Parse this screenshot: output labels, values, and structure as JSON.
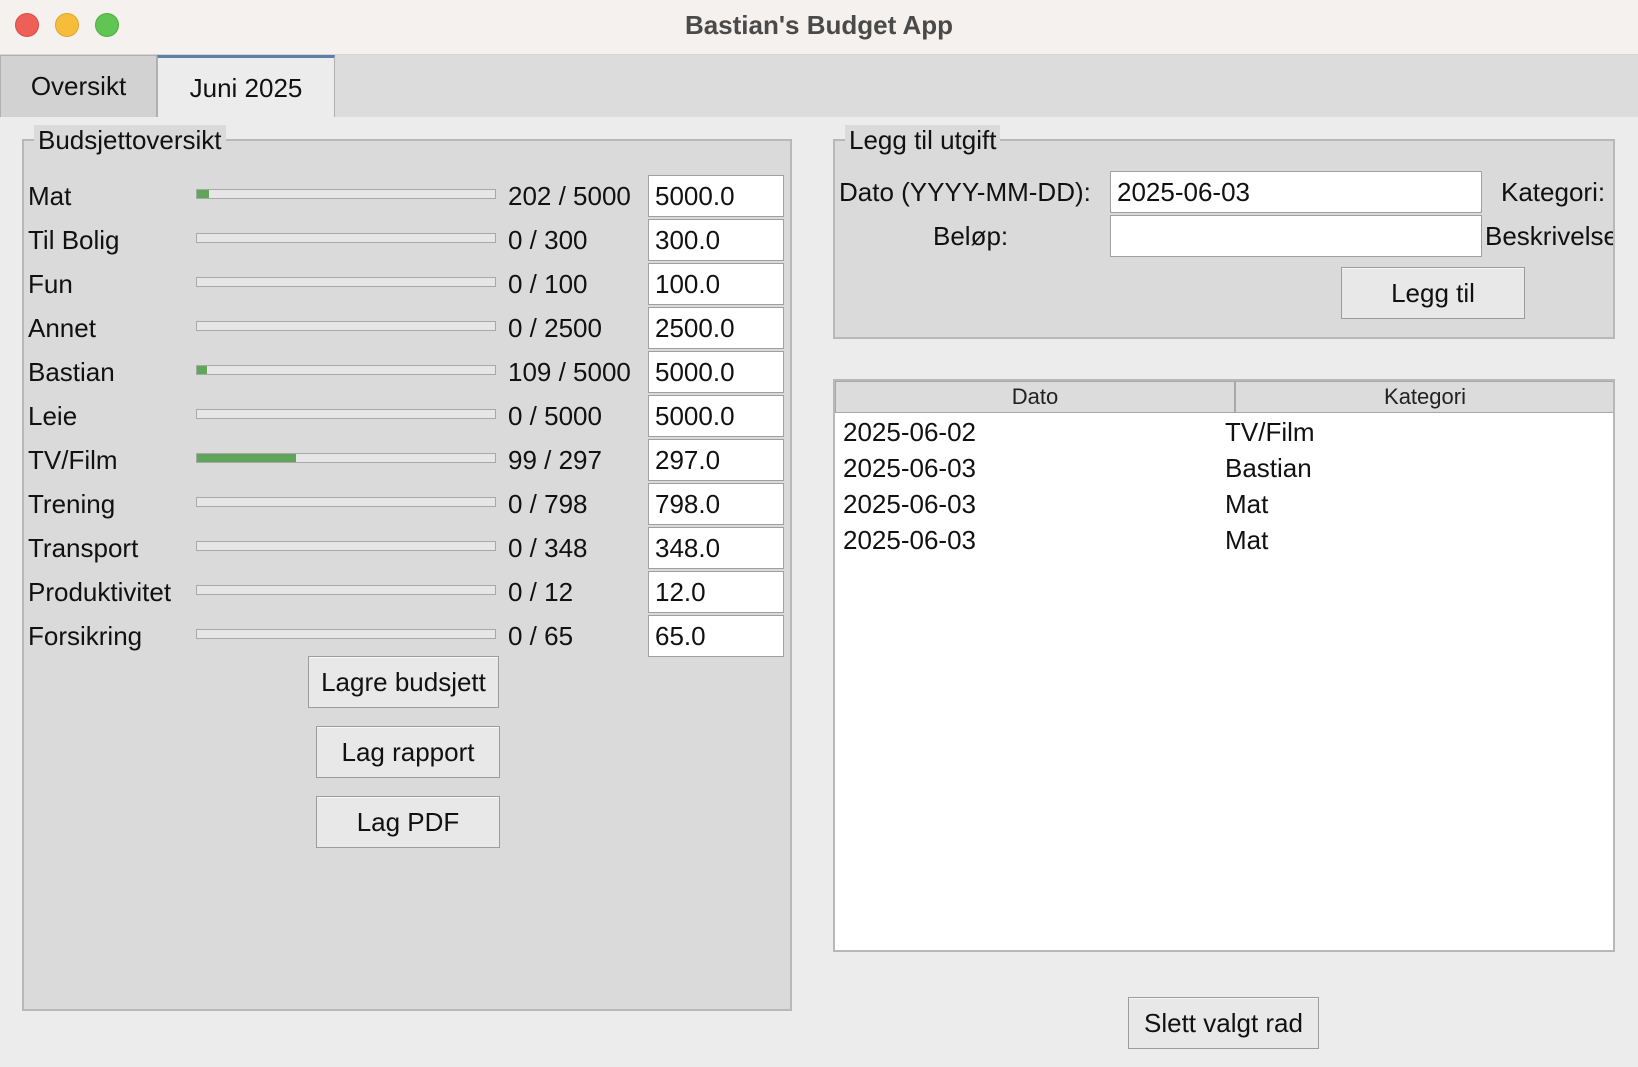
{
  "window": {
    "title": "Bastian's Budget App"
  },
  "tabs": [
    {
      "label": "Oversikt",
      "selected": false
    },
    {
      "label": "Juni 2025",
      "selected": true
    }
  ],
  "budget": {
    "title": "Budsjettoversikt",
    "rows": [
      {
        "category": "Mat",
        "progress": 0.04,
        "amount": "202 / 5000",
        "budget": "5000.0"
      },
      {
        "category": "Til Bolig",
        "progress": 0,
        "amount": "0 / 300",
        "budget": "300.0"
      },
      {
        "category": "Fun",
        "progress": 0,
        "amount": "0 / 100",
        "budget": "100.0"
      },
      {
        "category": "Annet",
        "progress": 0,
        "amount": "0 / 2500",
        "budget": "2500.0"
      },
      {
        "category": "Bastian",
        "progress": 0.022,
        "amount": "109 / 5000",
        "budget": "5000.0"
      },
      {
        "category": "Leie",
        "progress": 0,
        "amount": "0 / 5000",
        "budget": "5000.0"
      },
      {
        "category": "TV/Film",
        "progress": 0.333,
        "amount": "99 / 297",
        "budget": "297.0"
      },
      {
        "category": "Trening",
        "progress": 0,
        "amount": "0 / 798",
        "budget": "798.0"
      },
      {
        "category": "Transport",
        "progress": 0,
        "amount": "0 / 348",
        "budget": "348.0"
      },
      {
        "category": "Produktivitet",
        "progress": 0,
        "amount": "0 / 12",
        "budget": "12.0"
      },
      {
        "category": "Forsikring",
        "progress": 0,
        "amount": "0 / 65",
        "budget": "65.0"
      }
    ],
    "save_label": "Lagre budsjett",
    "report_label": "Lag rapport",
    "pdf_label": "Lag PDF"
  },
  "expense_form": {
    "title": "Legg til utgift",
    "date_label": "Dato (YYYY-MM-DD):",
    "date_value": "2025-06-03",
    "category_label": "Kategori:",
    "amount_label": "Beløp:",
    "amount_value": "",
    "description_label": "Beskrivelse",
    "add_label": "Legg til"
  },
  "expense_table": {
    "columns": [
      "Dato",
      "Kategori"
    ],
    "rows": [
      [
        "2025-06-02",
        "TV/Film"
      ],
      [
        "2025-06-03",
        "Bastian"
      ],
      [
        "2025-06-03",
        "Mat"
      ],
      [
        "2025-06-03",
        "Mat"
      ]
    ]
  },
  "delete_label": "Slett valgt rad",
  "colors": {
    "progress_fill": "#5fa65a",
    "tab_accent": "#5b7fa6"
  }
}
